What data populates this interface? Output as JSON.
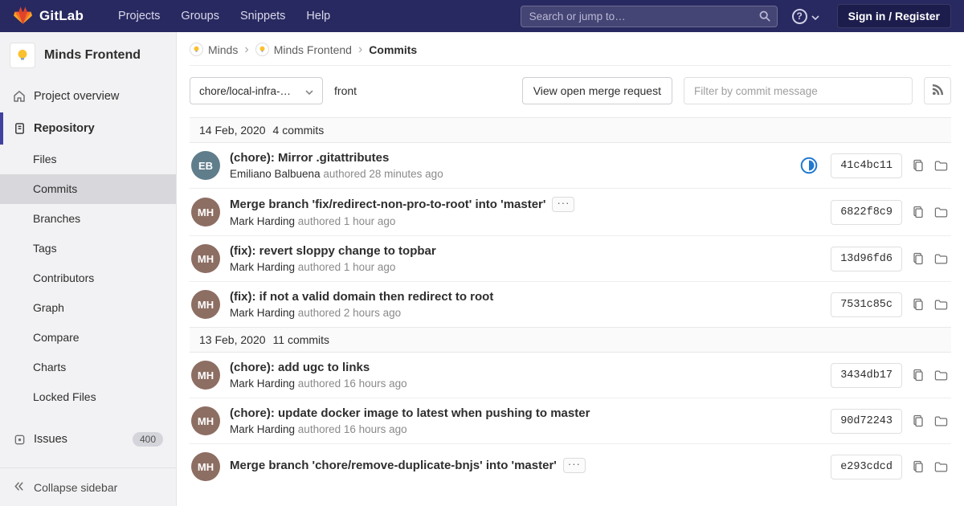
{
  "ui": {
    "breadcrumb_separator": "›",
    "expand_button": "···",
    "help_glyph": "?"
  },
  "colors": {
    "navbar_bg": "#292961",
    "sidebar_active_accent": "#41419f",
    "ci_running_blue": "#1f78d1",
    "tanuki_red": "#e24329",
    "tanuki_orange": "#fc6d26",
    "tanuki_yellow": "#fca326"
  },
  "navbar": {
    "brand": "GitLab",
    "links": [
      {
        "label": "Projects"
      },
      {
        "label": "Groups"
      },
      {
        "label": "Snippets"
      },
      {
        "label": "Help"
      }
    ],
    "search_placeholder": "Search or jump to…",
    "signin_label": "Sign in / Register"
  },
  "sidebar": {
    "project_name": "Minds Frontend",
    "overview_label": "Project overview",
    "repository_label": "Repository",
    "repository_items": [
      "Files",
      "Commits",
      "Branches",
      "Tags",
      "Contributors",
      "Graph",
      "Compare",
      "Charts",
      "Locked Files"
    ],
    "issues_label": "Issues",
    "issues_badge": "400",
    "collapse_label": "Collapse sidebar"
  },
  "breadcrumb": {
    "group": "Minds",
    "project": "Minds Frontend",
    "page": "Commits"
  },
  "controls": {
    "branch": "chore/local-infra-…",
    "ref_path": "front",
    "merge_request_button": "View open merge request",
    "filter_placeholder": "Filter by commit message"
  },
  "commits": {
    "groups": [
      {
        "date": "14 Feb, 2020",
        "count": "4 commits",
        "items": [
          {
            "title": "(chore): Mirror .gitattributes",
            "author": "Emiliano Balbuena",
            "time": "authored 28 minutes ago",
            "sha": "41c4bc11",
            "initials": "EB",
            "ci_status": "running"
          },
          {
            "title": "Merge branch 'fix/redirect-non-pro-to-root' into 'master'",
            "author": "Mark Harding",
            "time": "authored 1 hour ago",
            "sha": "6822f8c9",
            "initials": "MH"
          },
          {
            "title": "(fix): revert sloppy change to topbar",
            "author": "Mark Harding",
            "time": "authored 1 hour ago",
            "sha": "13d96fd6",
            "initials": "MH"
          },
          {
            "title": "(fix): if not a valid domain then redirect to root",
            "author": "Mark Harding",
            "time": "authored 2 hours ago",
            "sha": "7531c85c",
            "initials": "MH"
          }
        ]
      },
      {
        "date": "13 Feb, 2020",
        "count": "11 commits",
        "items": [
          {
            "title": "(chore): add ugc to links",
            "author": "Mark Harding",
            "time": "authored 16 hours ago",
            "sha": "3434db17",
            "initials": "MH"
          },
          {
            "title": "(chore): update docker image to latest when pushing to master",
            "author": "Mark Harding",
            "time": "authored 16 hours ago",
            "sha": "90d72243",
            "initials": "MH"
          },
          {
            "title": "Merge branch 'chore/remove-duplicate-bnjs' into 'master'",
            "author": "",
            "time": "",
            "sha": "e293cdcd",
            "initials": "MH"
          }
        ]
      }
    ]
  }
}
